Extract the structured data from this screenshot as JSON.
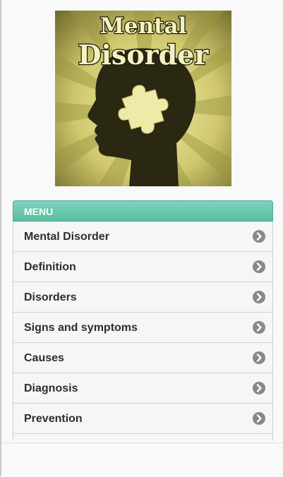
{
  "logo": {
    "title_line1": "Mental",
    "title_line2": "Disorder"
  },
  "menu": {
    "header": "MENU",
    "items": [
      {
        "label": "Mental Disorder"
      },
      {
        "label": "Definition"
      },
      {
        "label": "Disorders"
      },
      {
        "label": "Signs and symptoms"
      },
      {
        "label": "Causes"
      },
      {
        "label": "Diagnosis"
      },
      {
        "label": "Prevention"
      }
    ]
  },
  "colors": {
    "header_green": "#5bbf9f",
    "chevron_gray": "#888888",
    "logo_tone": "#d4cf7a"
  }
}
